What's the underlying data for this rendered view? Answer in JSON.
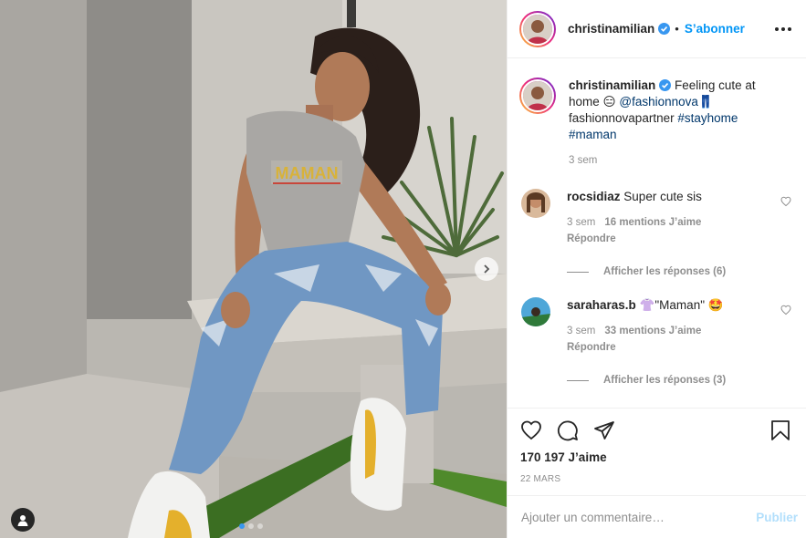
{
  "post": {
    "author": {
      "username": "christinamilian",
      "separator": "•",
      "follow_label": "S’abonner"
    },
    "photo": {
      "shirt_text": "MAMAN"
    },
    "caption": {
      "username": "christinamilian",
      "text_1": "Feeling cute at home",
      "emoji_1": "😑",
      "mention": "@fashionnova",
      "emoji_2": "👖",
      "text_2": "fashionnovapartner",
      "hashtag_1": "#stayhome",
      "hashtag_2": "#maman",
      "time": "3 sem"
    },
    "comments": [
      {
        "username": "rocsidiaz",
        "text": "Super cute sis",
        "time": "3 sem",
        "likes": "16 mentions J’aime",
        "reply_label": "Répondre",
        "view_replies": "Afficher les réponses (6)"
      },
      {
        "username": "saraharas.b",
        "emoji_before": "👚",
        "text": "\"Maman\"",
        "emoji_after": "🤩",
        "time": "3 sem",
        "likes": "33 mentions J’aime",
        "reply_label": "Répondre",
        "view_replies": "Afficher les réponses (3)"
      }
    ],
    "likes_count": "170 197 J’aime",
    "date": "22 MARS",
    "comment_input": {
      "placeholder": "Ajouter un commentaire…"
    },
    "publish_label": "Publier",
    "carousel": {
      "total": 3,
      "active_index": 0
    }
  },
  "colors": {
    "accent_blue": "#0095f6",
    "verified_blue": "#3897f0",
    "muted_text": "#8e8e8e",
    "link_dark": "#00376b",
    "publish_disabled": "#b2dffc"
  },
  "icons": [
    "verified-icon",
    "more-icon",
    "heart-icon",
    "comment-icon",
    "share-icon",
    "save-icon",
    "chevron-right-icon",
    "user-tag-icon"
  ]
}
